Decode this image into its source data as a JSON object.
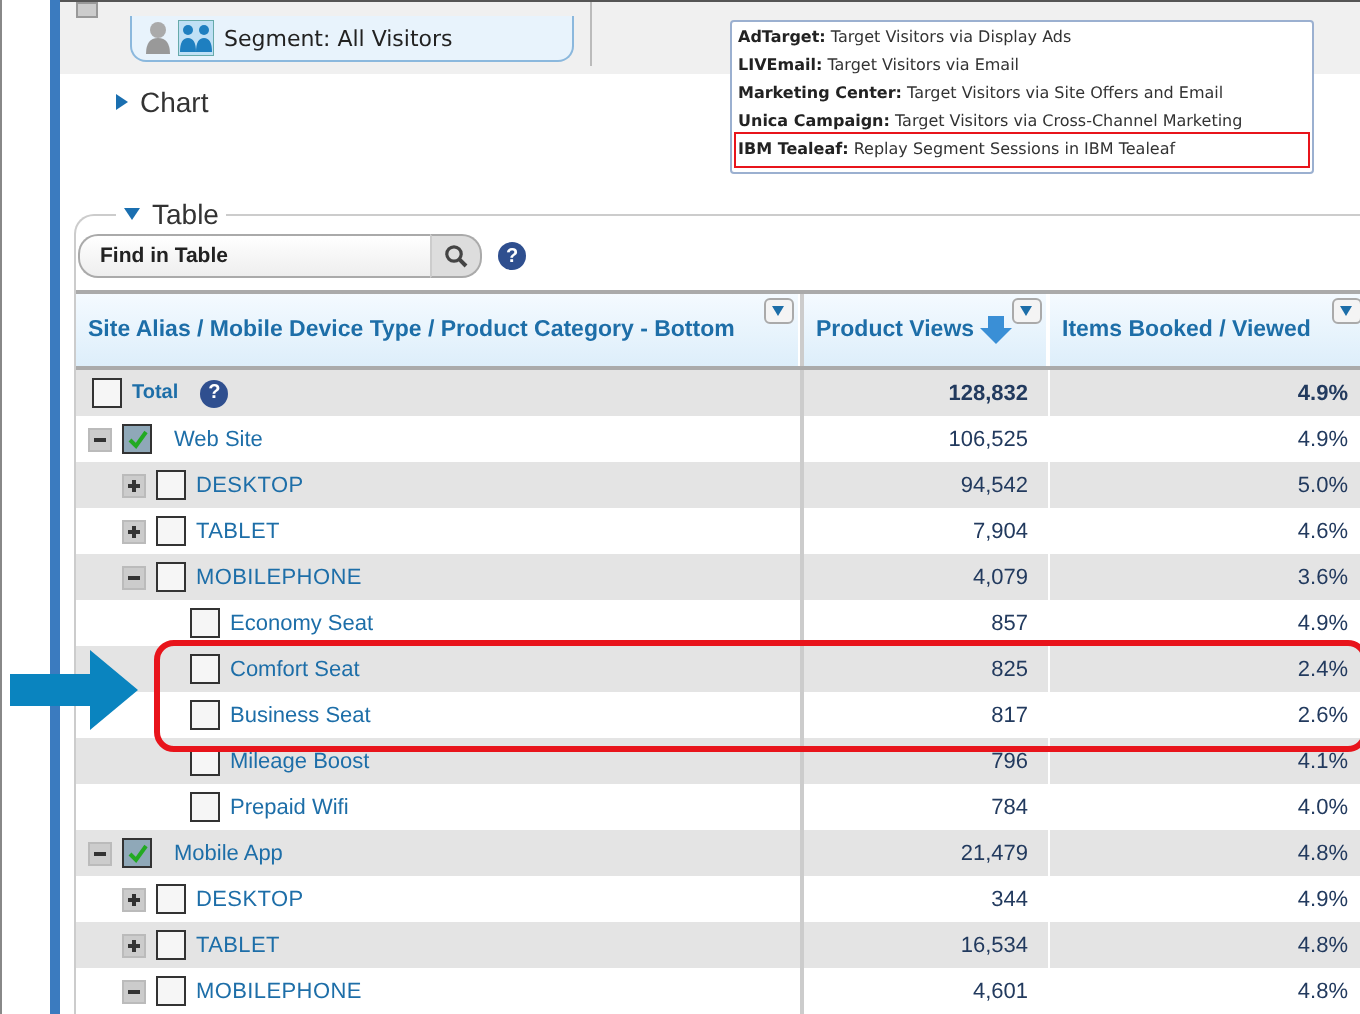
{
  "segment": {
    "label": "Segment: All Visitors"
  },
  "integrations_popup": [
    {
      "name": "AdTarget:",
      "text": "Target Visitors via Display Ads",
      "marked": false
    },
    {
      "name": "LIVEmail:",
      "text": "Target Visitors via Email",
      "marked": false
    },
    {
      "name": "Marketing Center:",
      "text": "Target Visitors via Site Offers and Email",
      "marked": false
    },
    {
      "name": "Unica Campaign:",
      "text": "Target Visitors via Cross-Channel Marketing",
      "marked": false
    },
    {
      "name": "IBM Tealeaf:",
      "text": "Replay Segment Sessions in IBM Tealeaf",
      "marked": true
    }
  ],
  "chart_section": {
    "title": "Chart",
    "expanded": false
  },
  "table_section": {
    "title": "Table",
    "expanded": true,
    "search": {
      "value": "Find in Table",
      "help": "?"
    },
    "columns": [
      {
        "label": "Site Alias / Mobile Device Type / Product Category - Bottom",
        "sorted": false
      },
      {
        "label": "Product Views",
        "sorted": true
      },
      {
        "label": "Items Booked / Viewed",
        "sorted": false
      }
    ],
    "total": {
      "label": "Total",
      "help": "?",
      "checked": false,
      "values": [
        "128,832",
        "4.9%"
      ]
    },
    "rows": [
      {
        "label": "Web Site",
        "checked": true,
        "expanded": true,
        "values": [
          "106,525",
          "4.9%"
        ],
        "children": [
          {
            "label": "DESKTOP",
            "checked": false,
            "expanded": false,
            "values": [
              "94,542",
              "5.0%"
            ]
          },
          {
            "label": "TABLET",
            "checked": false,
            "expanded": false,
            "values": [
              "7,904",
              "4.6%"
            ]
          },
          {
            "label": "MOBILEPHONE",
            "checked": false,
            "expanded": true,
            "values": [
              "4,079",
              "3.6%"
            ],
            "children": [
              {
                "label": "Economy Seat",
                "checked": false,
                "marked": false,
                "values": [
                  "857",
                  "4.9%"
                ]
              },
              {
                "label": "Comfort Seat",
                "checked": false,
                "marked": true,
                "values": [
                  "825",
                  "2.4%"
                ]
              },
              {
                "label": "Business Seat",
                "checked": false,
                "marked": true,
                "values": [
                  "817",
                  "2.6%"
                ]
              },
              {
                "label": "Mileage Boost",
                "checked": false,
                "marked": false,
                "values": [
                  "796",
                  "4.1%"
                ]
              },
              {
                "label": "Prepaid Wifi",
                "checked": false,
                "marked": false,
                "values": [
                  "784",
                  "4.0%"
                ]
              }
            ]
          }
        ]
      },
      {
        "label": "Mobile App",
        "checked": true,
        "expanded": true,
        "values": [
          "21,479",
          "4.8%"
        ],
        "children": [
          {
            "label": "DESKTOP",
            "checked": false,
            "expanded": false,
            "values": [
              "344",
              "4.9%"
            ]
          },
          {
            "label": "TABLET",
            "checked": false,
            "expanded": false,
            "values": [
              "16,534",
              "4.8%"
            ]
          },
          {
            "label": "MOBILEPHONE",
            "checked": false,
            "expanded": true,
            "values": [
              "4,601",
              "4.8%"
            ]
          }
        ]
      }
    ]
  }
}
